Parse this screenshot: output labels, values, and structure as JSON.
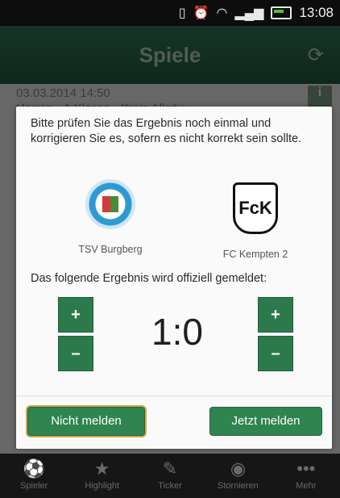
{
  "status": {
    "time": "13:08",
    "icons": [
      "vibrate-icon",
      "alarm-icon",
      "wifi-icon",
      "signal-icon",
      "battery-icon"
    ]
  },
  "header": {
    "title": "Spiele",
    "refresh_icon": "refresh-icon"
  },
  "background": {
    "date_line": "03.03.2014  14:50",
    "league_line": "Herren - A Klasse - Kreis Allgäu",
    "info_label": "i"
  },
  "dialog": {
    "message": "Bitte prüfen Sie das Ergebnis noch einmal und korrigieren Sie es, sofern es nicht korrekt sein sollte.",
    "home_team": "TSV Burgberg",
    "away_team": "FC Kempten 2",
    "away_logo_text": "FcK",
    "note": "Das folgende Ergebnis wird offiziell gemeldet:",
    "score": "1:0",
    "plus": "+",
    "minus": "–",
    "cancel_label": "Nicht melden",
    "report_label": "Jetzt melden"
  },
  "nav": {
    "items": [
      {
        "label": "Spieler",
        "icon": "player-icon"
      },
      {
        "label": "Highlight",
        "icon": "star-icon"
      },
      {
        "label": "Ticker",
        "icon": "pencil-icon"
      },
      {
        "label": "Stornieren",
        "icon": "cancel-circle-icon"
      },
      {
        "label": "Mehr",
        "icon": "more-icon"
      }
    ]
  },
  "colors": {
    "accent": "#2f8450",
    "header": "#1f5038"
  }
}
